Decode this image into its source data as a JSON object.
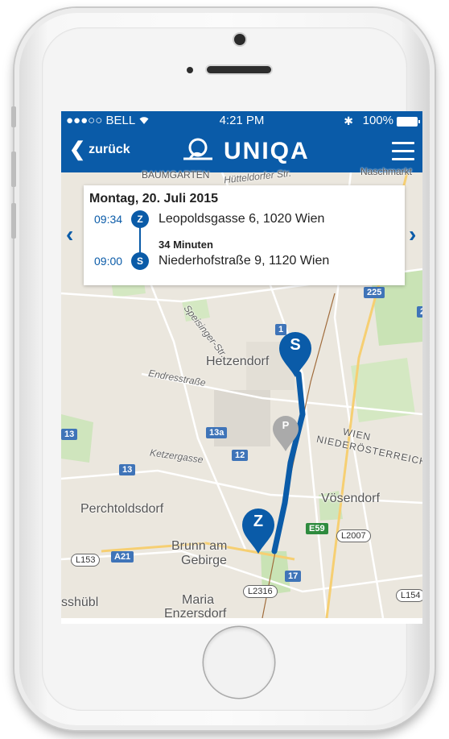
{
  "status_bar": {
    "carrier": "●●●○○ BELL",
    "time": "4:21 PM",
    "battery": "100%",
    "bluetooth_icon": "bluetooth-icon",
    "wifi_icon": "wifi-icon"
  },
  "nav": {
    "back_label": "zurück",
    "brand": "UNIQA",
    "menu_icon": "hamburger-menu-icon"
  },
  "trip": {
    "date": "Montag, 20. Juli 2015",
    "end": {
      "time": "09:34",
      "badge": "Z",
      "address": "Leopoldsgasse 6, 1020 Wien"
    },
    "duration": "34 Minuten",
    "start": {
      "time": "09:00",
      "badge": "S",
      "address": "Niederhofstraße 9, 1120 Wien"
    }
  },
  "map": {
    "labels": {
      "hetzendorf": "Hetzendorf",
      "endresstrasse": "Endresstraße",
      "speisinger": "Speisinger-Str.",
      "ketzergasse": "Ketzergasse",
      "perchtoldsdorf": "Perchtoldsdorf",
      "brunn": "Brunn am",
      "gebirge": "Gebirge",
      "maria": "Maria",
      "enzersdorf": "Enzersdorf",
      "voesendorf": "Vösendorf",
      "niederoesterreich": "NIEDERÖSTERREICH",
      "wien": "WIEN",
      "hietzing_street": "Hütteldorfer Str.",
      "naschmarkt": "Naschmarkt",
      "baumgarten": "BAUMGARTEN",
      "sshuebl": "sshübl"
    },
    "shields": {
      "s225": "225",
      "s2": "2",
      "s13a": "13a",
      "s13_left": "13",
      "s13_mid": "13",
      "s12": "12",
      "s17": "17",
      "sA21": "A21",
      "sE59": "E59",
      "s1": "1"
    },
    "road_tags": {
      "l2007": "L2007",
      "l153": "L153",
      "l2316": "L2316",
      "l154": "L154"
    },
    "pins": {
      "start": "S",
      "end": "Z",
      "parking": "P"
    },
    "arrows": {
      "prev": "‹",
      "next": "›"
    },
    "colors": {
      "route": "#0a5ba8",
      "pin": "#0a5ba8",
      "parking": "#aaaaaa"
    }
  }
}
